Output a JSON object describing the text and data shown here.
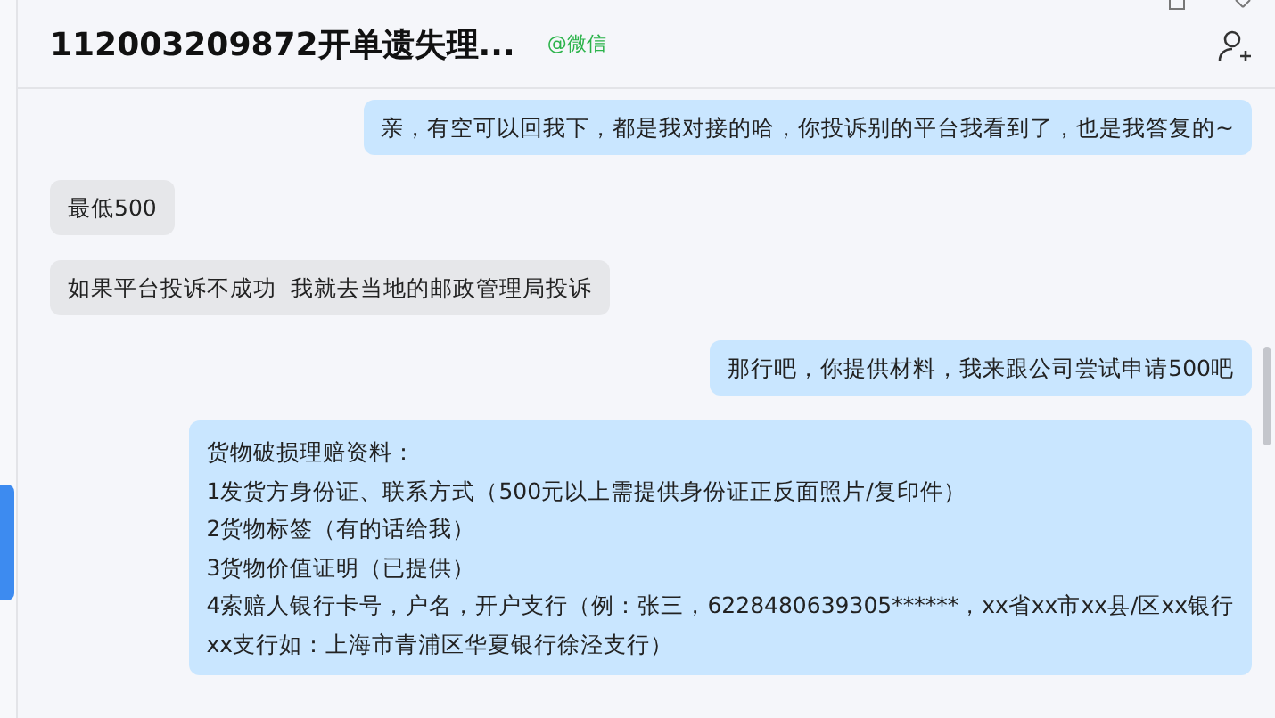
{
  "header": {
    "title": "112003209872开单遗失理...",
    "source": "@微信"
  },
  "messages": [
    {
      "kind": "sent",
      "lines": [
        "亲，有空可以回我下，都是我对接的哈，你投诉别的平台我看到了，也是我答复的~"
      ]
    },
    {
      "kind": "received",
      "lines": [
        "最低500"
      ]
    },
    {
      "kind": "received",
      "lines": [
        "如果平台投诉不成功  我就去当地的邮政管理局投诉"
      ]
    },
    {
      "kind": "sent",
      "lines": [
        "那行吧，你提供材料，我来跟公司尝试申请500吧"
      ]
    },
    {
      "kind": "sent",
      "lines": [
        "货物破损理赔资料：",
        "1发货方身份证、联系方式（500元以上需提供身份证正反面照片/复印件）",
        "2货物标签（有的话给我）",
        "3货物价值证明（已提供）",
        "4索赔人银行卡号，户名，开户支行（例：张三，6228480639305******，xx省xx市xx县/区xx银行",
        "xx支行如：上海市青浦区华夏银行徐泾支行）"
      ]
    }
  ]
}
